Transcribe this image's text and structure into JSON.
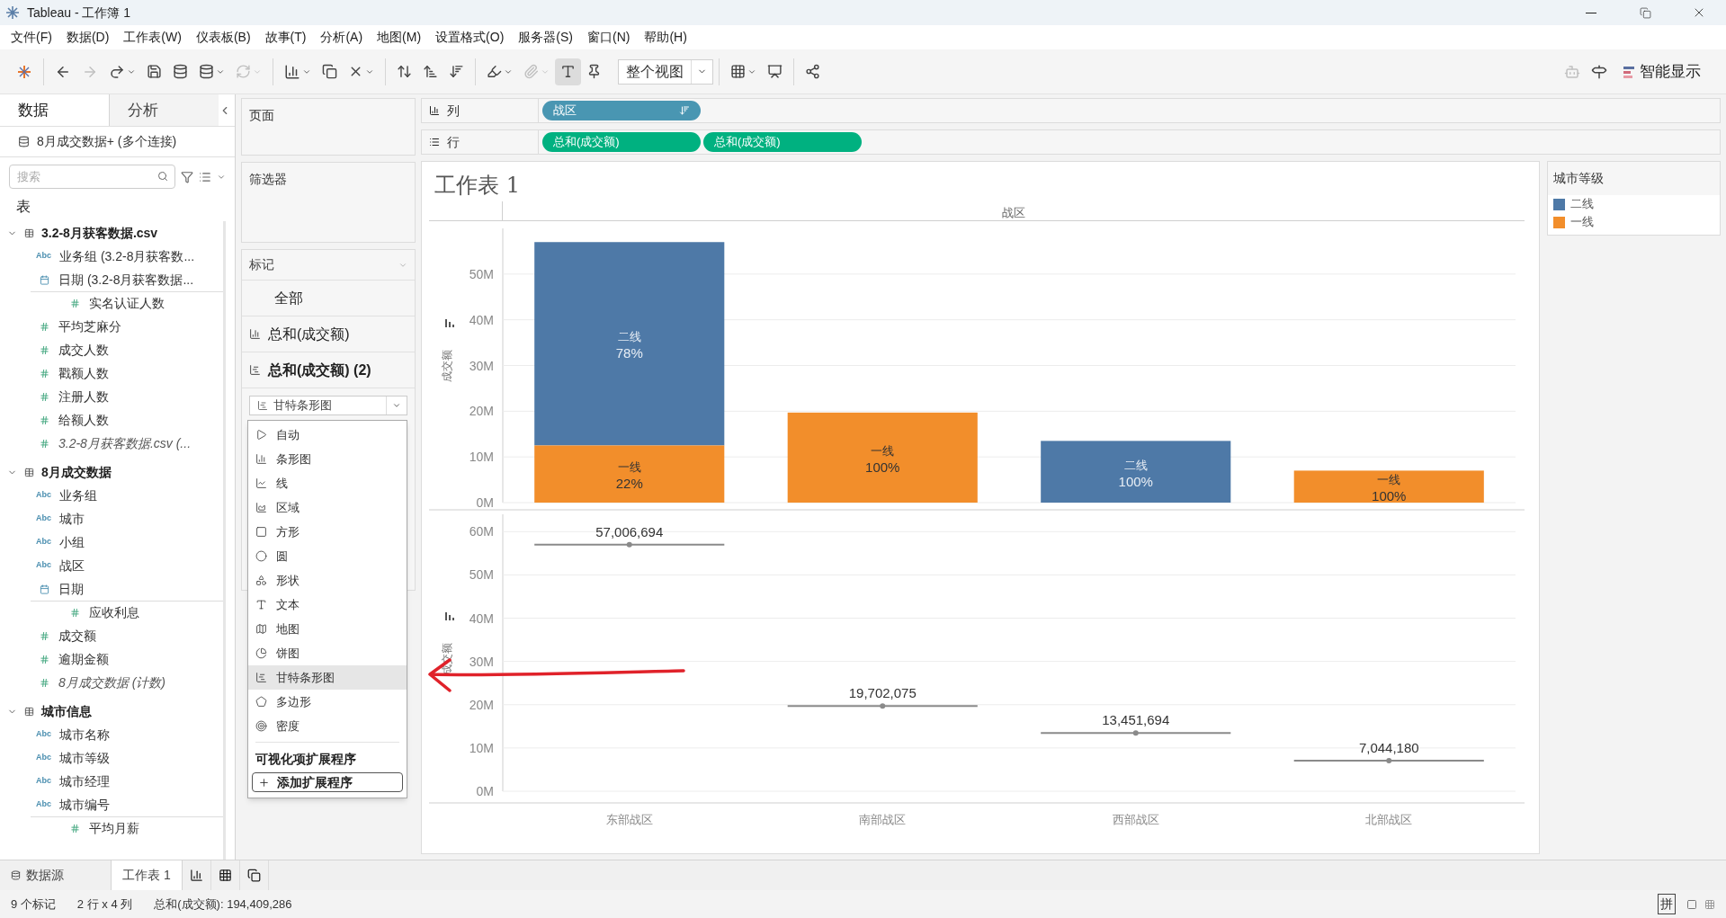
{
  "window": {
    "title": "Tableau - 工作簿 1"
  },
  "menu": [
    "文件(F)",
    "数据(D)",
    "工作表(W)",
    "仪表板(B)",
    "故事(T)",
    "分析(A)",
    "地图(M)",
    "设置格式(O)",
    "服务器(S)",
    "窗口(N)",
    "帮助(H)"
  ],
  "toolbar": {
    "fit": "整个视图",
    "show_me": "智能显示"
  },
  "data_pane": {
    "tabs": [
      {
        "label": "数据",
        "selected": true
      },
      {
        "label": "分析",
        "selected": false
      }
    ],
    "connection": "8月成交数据+ (多个连接)",
    "search": {
      "placeholder": "搜索"
    },
    "tables_heading": "表",
    "tables": [
      {
        "name": "3.2-8月获客数据.csv",
        "expanded": true,
        "fields": [
          {
            "kind": "text",
            "badge": "Abc",
            "name": "业务组 (3.2-8月获客数..."
          },
          {
            "kind": "date",
            "name": "日期 (3.2-8月获客数据..."
          },
          {
            "kind": "measure",
            "name": "实名认证人数"
          },
          {
            "kind": "measure",
            "name": "平均芝麻分"
          },
          {
            "kind": "measure",
            "name": "成交人数"
          },
          {
            "kind": "measure",
            "name": "戳额人数"
          },
          {
            "kind": "measure",
            "name": "注册人数"
          },
          {
            "kind": "measure",
            "name": "给额人数"
          },
          {
            "kind": "generated",
            "name": "3.2-8月获客数据.csv (..."
          }
        ]
      },
      {
        "name": "8月成交数据",
        "expanded": true,
        "fields": [
          {
            "kind": "text",
            "badge": "Abc",
            "name": "业务组"
          },
          {
            "kind": "text",
            "badge": "Abc",
            "name": "城市"
          },
          {
            "kind": "text",
            "badge": "Abc",
            "name": "小组"
          },
          {
            "kind": "text",
            "badge": "Abc",
            "name": "战区"
          },
          {
            "kind": "date",
            "name": "日期"
          },
          {
            "kind": "measure",
            "name": "应收利息"
          },
          {
            "kind": "measure",
            "name": "成交额"
          },
          {
            "kind": "measure",
            "name": "逾期金额"
          },
          {
            "kind": "generated",
            "name": "8月成交数据 (计数)"
          }
        ]
      },
      {
        "name": "城市信息",
        "expanded": true,
        "fields": [
          {
            "kind": "text",
            "badge": "Abc",
            "name": "城市名称"
          },
          {
            "kind": "text",
            "badge": "Abc",
            "name": "城市等级"
          },
          {
            "kind": "text",
            "badge": "Abc",
            "name": "城市经理"
          },
          {
            "kind": "text",
            "badge": "Abc",
            "name": "城市编号"
          },
          {
            "kind": "measure",
            "name": "平均月薪"
          }
        ]
      }
    ]
  },
  "pages_shelf": "页面",
  "filters_shelf": "筛选器",
  "columns_shelf": {
    "label": "列",
    "pills": [
      {
        "kind": "dimension",
        "text": "战区"
      }
    ]
  },
  "rows_shelf": {
    "label": "行",
    "pills": [
      {
        "kind": "measure",
        "text": "总和(成交额)"
      },
      {
        "kind": "measure",
        "text": "总和(成交额)"
      }
    ]
  },
  "marks": {
    "title": "标记",
    "cards": [
      {
        "kind": "all",
        "label": "全部",
        "selected": false
      },
      {
        "kind": "bar",
        "label": "总和(成交额)",
        "selected": false
      },
      {
        "kind": "gantt",
        "label": "总和(成交额) (2)",
        "selected": true
      }
    ],
    "mark_type": "甘特条形图",
    "menu": [
      {
        "kind": "auto",
        "label": "自动",
        "selected": false
      },
      {
        "kind": "bar",
        "label": "条形图",
        "selected": false
      },
      {
        "kind": "line",
        "label": "线",
        "selected": false
      },
      {
        "kind": "area",
        "label": "区域",
        "selected": false
      },
      {
        "kind": "square",
        "label": "方形",
        "selected": false
      },
      {
        "kind": "circle",
        "label": "圆",
        "selected": false
      },
      {
        "kind": "shape",
        "label": "形状",
        "selected": false
      },
      {
        "kind": "text",
        "label": "文本",
        "selected": false
      },
      {
        "kind": "map",
        "label": "地图",
        "selected": false
      },
      {
        "kind": "pie",
        "label": "饼图",
        "selected": false
      },
      {
        "kind": "gantt",
        "label": "甘特条形图",
        "selected": true
      },
      {
        "kind": "polygon",
        "label": "多边形",
        "selected": false
      },
      {
        "kind": "density",
        "label": "密度",
        "selected": false
      }
    ],
    "extensions_heading": "可视化项扩展程序",
    "add_extension": "添加扩展程序"
  },
  "worksheet": {
    "title": "工作表 1",
    "column_header": "战区",
    "panes": [
      {
        "chart_data": {
          "type": "bar",
          "stacked": true,
          "grid": true,
          "ylabel": "成交额",
          "ylim": [
            0,
            60000000
          ],
          "yticks": [
            {
              "value": 0,
              "label": "0M"
            },
            {
              "value": 10000000,
              "label": "10M"
            },
            {
              "value": 20000000,
              "label": "20M"
            },
            {
              "value": 30000000,
              "label": "30M"
            },
            {
              "value": 40000000,
              "label": "40M"
            },
            {
              "value": 50000000,
              "label": "50M"
            }
          ],
          "series": [
            {
              "name": "二线",
              "color": "#4e79a7",
              "values": [
                44500000,
                0,
                13500000,
                0
              ]
            },
            {
              "name": "一线",
              "color": "#f28e2b",
              "values": [
                12500000,
                19700000,
                0,
                7000000
              ]
            }
          ],
          "value_labels": [
            [
              {
                "name": "二线",
                "value": "78%"
              },
              {
                "name": "一线",
                "value": "22%"
              }
            ],
            [
              {
                "name": "一线",
                "value": "100%"
              }
            ],
            [
              {
                "name": "二线",
                "value": "100%"
              }
            ],
            [
              {
                "name": "一线",
                "value": "100%"
              }
            ]
          ]
        }
      },
      {
        "chart_data": {
          "type": "scatter",
          "grid": true,
          "ylabel": "成交额",
          "categories": [
            "东部战区",
            "南部战区",
            "西部战区",
            "北部战区"
          ],
          "ylim": [
            0,
            64000000
          ],
          "yticks": [
            {
              "value": 0,
              "label": "0M"
            },
            {
              "value": 10000000,
              "label": "10M"
            },
            {
              "value": 20000000,
              "label": "20M"
            },
            {
              "value": 30000000,
              "label": "30M"
            },
            {
              "value": 40000000,
              "label": "40M"
            },
            {
              "value": 50000000,
              "label": "50M"
            },
            {
              "value": 60000000,
              "label": "60M"
            }
          ],
          "values": [
            57006694,
            19702075,
            13451694,
            7044180
          ],
          "value_labels": [
            "57,006,694",
            "19,702,075",
            "13,451,694",
            "7,044,180"
          ]
        }
      }
    ]
  },
  "legend": {
    "title": "城市等级"
  },
  "sheet_tabs": {
    "data_source": "数据源",
    "tabs": [
      {
        "label": "工作表 1",
        "selected": true
      }
    ]
  },
  "status_bar": [
    "9 个标记",
    "2 行 x 4 列",
    "总和(成交额): 194,409,286"
  ],
  "ime": "拼"
}
